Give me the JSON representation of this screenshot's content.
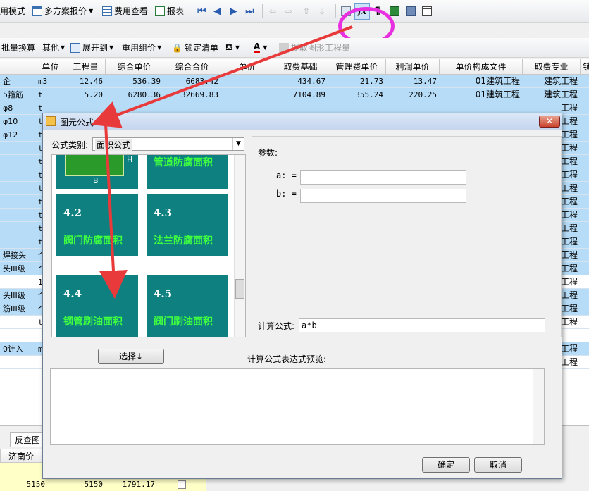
{
  "toolbar1": {
    "mode_label": "用模式",
    "multi_plan_label": "多方案报价",
    "cost_view_label": "费用查看",
    "report_label": "报表"
  },
  "toolbar2": {
    "batch_convert_label": "批量换算",
    "other_label": "其他",
    "expand_to_label": "展开到",
    "reuse_group_label": "重用组价",
    "lock_list_label": "锁定清单",
    "extract_label": "提取图形工程量"
  },
  "grid": {
    "headers": [
      "单位",
      "工程量",
      "综合单价",
      "综合合价",
      "单价",
      "取费基础",
      "管理费单价",
      "利润单价",
      "单价构成文件",
      "取费专业",
      "锁"
    ],
    "rows": [
      {
        "name": "企",
        "unit": "m3",
        "qty": "12.46",
        "uprice": "536.39",
        "total": "6683.42",
        "base": "434.67",
        "mgmt": "21.73",
        "profit": "13.47",
        "file": "01建筑工程",
        "major": "建筑工程"
      },
      {
        "name": "5箍筋",
        "unit": "t",
        "qty": "5.20",
        "uprice": "6280.36",
        "total": "32669.83",
        "base": "7104.89",
        "mgmt": "355.24",
        "profit": "220.25",
        "file": "01建筑工程",
        "major": "建筑工程"
      },
      {
        "name": "φ8",
        "unit": "t",
        "qty": "",
        "uprice": "",
        "total": "",
        "base": "",
        "mgmt": "",
        "profit": "",
        "file": "",
        "major": "工程"
      },
      {
        "name": "φ10",
        "unit": "t",
        "qty": "",
        "uprice": "",
        "total": "",
        "base": "",
        "mgmt": "",
        "profit": "",
        "file": "",
        "major": "工程"
      },
      {
        "name": "φ12",
        "unit": "t",
        "qty": "",
        "uprice": "",
        "total": "",
        "base": "",
        "mgmt": "",
        "profit": "",
        "file": "",
        "major": "工程"
      },
      {
        "name": "",
        "unit": "t",
        "qty": "",
        "uprice": "",
        "total": "",
        "base": "",
        "mgmt": "",
        "profit": "",
        "file": "",
        "major": "工程"
      },
      {
        "name": "",
        "unit": "t",
        "qty": "",
        "uprice": "",
        "total": "",
        "base": "",
        "mgmt": "",
        "profit": "",
        "file": "",
        "major": "工程"
      },
      {
        "name": "",
        "unit": "t",
        "qty": "",
        "uprice": "",
        "total": "",
        "base": "",
        "mgmt": "",
        "profit": "",
        "file": "",
        "major": "工程"
      },
      {
        "name": "",
        "unit": "t",
        "qty": "",
        "uprice": "",
        "total": "",
        "base": "",
        "mgmt": "",
        "profit": "",
        "file": "",
        "major": "工程"
      },
      {
        "name": "",
        "unit": "t",
        "qty": "",
        "uprice": "",
        "total": "",
        "base": "",
        "mgmt": "",
        "profit": "",
        "file": "",
        "major": "工程"
      },
      {
        "name": "",
        "unit": "t",
        "qty": "",
        "uprice": "",
        "total": "",
        "base": "",
        "mgmt": "",
        "profit": "",
        "file": "",
        "major": "工程"
      },
      {
        "name": "",
        "unit": "t",
        "qty": "",
        "uprice": "",
        "total": "",
        "base": "",
        "mgmt": "",
        "profit": "",
        "file": "",
        "major": "工程"
      },
      {
        "name": "",
        "unit": "t",
        "qty": "",
        "uprice": "",
        "total": "",
        "base": "",
        "mgmt": "",
        "profit": "",
        "file": "",
        "major": "工程"
      },
      {
        "name": "焊接头",
        "unit": "个",
        "qty": "",
        "uprice": "",
        "total": "",
        "base": "",
        "mgmt": "",
        "profit": "",
        "file": "",
        "major": "工程"
      },
      {
        "name": "头III级",
        "unit": "个",
        "qty": "",
        "uprice": "",
        "total": "",
        "base": "",
        "mgmt": "",
        "profit": "",
        "file": "",
        "major": "工程"
      },
      {
        "name": "",
        "unit": "10",
        "qty": "",
        "uprice": "",
        "total": "",
        "base": "",
        "mgmt": "",
        "profit": "",
        "file": "",
        "major": "工程"
      },
      {
        "name": "头III级",
        "unit": "个",
        "qty": "",
        "uprice": "",
        "total": "",
        "base": "",
        "mgmt": "",
        "profit": "",
        "file": "",
        "major": "工程"
      },
      {
        "name": "筋III级",
        "unit": "个",
        "qty": "",
        "uprice": "",
        "total": "",
        "base": "",
        "mgmt": "",
        "profit": "",
        "file": "",
        "major": "工程"
      },
      {
        "name": "",
        "unit": "t",
        "qty": "",
        "uprice": "",
        "total": "",
        "base": "",
        "mgmt": "",
        "profit": "",
        "file": "",
        "major": "工程"
      },
      {
        "name": "",
        "unit": "",
        "qty": "",
        "uprice": "",
        "total": "",
        "base": "",
        "mgmt": "",
        "profit": "",
        "file": "",
        "major": ""
      },
      {
        "name": "0计入",
        "unit": "m",
        "qty": "",
        "uprice": "",
        "total": "",
        "base": "",
        "mgmt": "",
        "profit": "",
        "file": "",
        "major": "工程"
      },
      {
        "name": "",
        "unit": "",
        "qty": "",
        "uprice": "",
        "total": "",
        "base": "",
        "mgmt": "",
        "profit": "",
        "file": "",
        "major": "工程"
      }
    ]
  },
  "bottom": {
    "tab_label": "反查图",
    "col_label": "济南价",
    "v1": "5150",
    "v2": "5150",
    "v3": "1791.17"
  },
  "dialog": {
    "title": "图元公式",
    "category_label": "公式类别:",
    "category_value": "面积公式",
    "top_card_label": "管道防腐面积",
    "cards": [
      {
        "num": "4.2",
        "label": "阀门防腐面积"
      },
      {
        "num": "4.3",
        "label": "法兰防腐面积"
      },
      {
        "num": "4.4",
        "label": "钢管刷油面积"
      },
      {
        "num": "4.5",
        "label": "阀门刷油面积"
      }
    ],
    "diagram_h": "H",
    "diagram_b": "B",
    "params_label": "参数:",
    "param_a": "a: =",
    "param_b": "b: =",
    "formula_label": "计算公式:",
    "formula_value": "a*b",
    "select_button": "选择↓",
    "preview_label": "计算公式表达式预览:",
    "ok_button": "确定",
    "cancel_button": "取消"
  },
  "colors": {
    "row_highlight": "#b6dcf7",
    "card_bg": "#0e8080",
    "card_text": "#3fff3f",
    "annotation": "#e83a3a",
    "circle": "#e830e0"
  }
}
